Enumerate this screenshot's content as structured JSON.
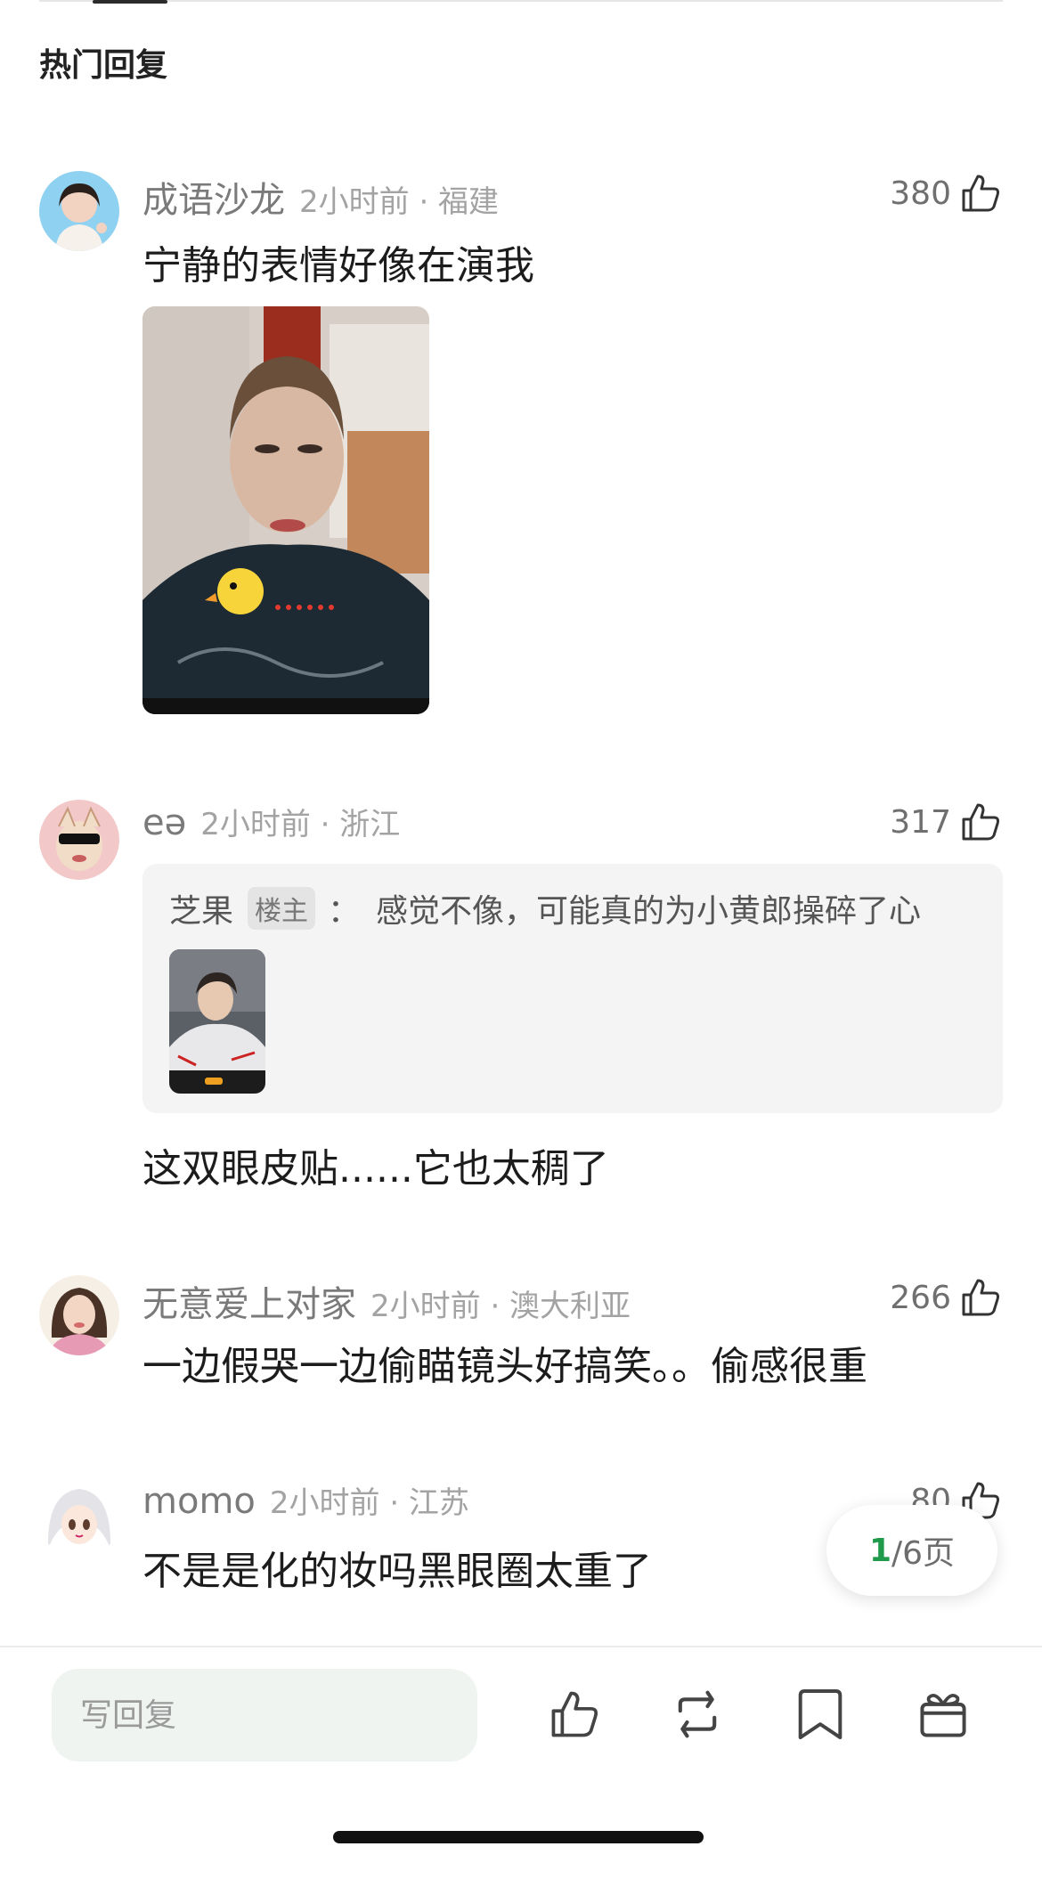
{
  "section_title": "热门回复",
  "comments": [
    {
      "user": "成语沙龙",
      "time_location": "2小时前 · 福建",
      "likes": "380",
      "text": "宁静的表情好像在演我",
      "has_image": true
    },
    {
      "user": "eə",
      "time_location": "2小时前 · 浙江",
      "likes": "317",
      "quote": {
        "user": "芝果",
        "badge": "楼主",
        "colon": "：",
        "text": "感觉不像，可能真的为小黄郎操碎了心"
      },
      "text": "这双眼皮贴......它也太稠了"
    },
    {
      "user": "无意爱上对家",
      "time_location": "2小时前 · 澳大利亚",
      "likes": "266",
      "text": "一边假哭一边偷瞄镜头好搞笑。。偷感很重"
    },
    {
      "user": "momo",
      "time_location": "2小时前 · 江苏",
      "likes": "80",
      "text": "不是是化的妆吗黑眼圈太重了"
    }
  ],
  "pager": {
    "current": "1",
    "total_label": "/6页"
  },
  "bottom_bar": {
    "reply_placeholder": "写回复",
    "icons": [
      "thumbs-up-icon",
      "repost-icon",
      "bookmark-icon",
      "gift-icon"
    ]
  },
  "colors": {
    "accent_green": "#1f9a4b",
    "meta_gray": "#a3a3a3"
  }
}
